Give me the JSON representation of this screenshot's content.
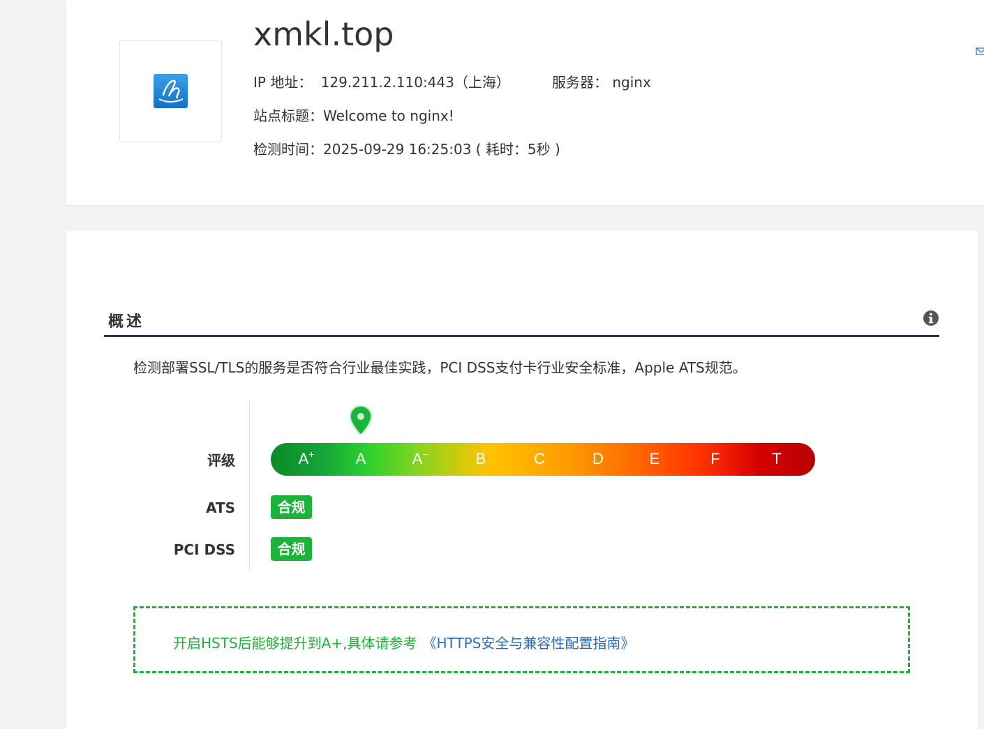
{
  "header": {
    "domain": "xmkl.top",
    "ip_label": "IP 地址：",
    "ip_value": "129.211.2.110:443（上海）",
    "server_label": "服务器：",
    "server_value": "nginx",
    "site_title_label": "站点标题：",
    "site_title_value": "Welcome to nginx!",
    "check_time_label": "检测时间：",
    "check_time_value": "2025-09-29 16:25:03 ( 耗时：5秒 )",
    "logo_icon": "site-favicon-h",
    "mail_icon": "envelope-icon"
  },
  "overview": {
    "title": "概述",
    "info_icon": "info-circle-icon",
    "description": "检测部署SSL/TLS的服务是否符合行业最佳实践，PCI DSS支付卡行业安全标准，Apple ATS规范。",
    "grade_label": "评级",
    "grades": [
      "A",
      "A",
      "A",
      "B",
      "C",
      "D",
      "E",
      "F",
      "T"
    ],
    "grade_superscripts": [
      "+",
      "",
      "−",
      "",
      "",
      "",
      "",
      "",
      ""
    ],
    "current_grade": "A",
    "ats_label": "ATS",
    "ats_status": "合规",
    "pci_label": "PCI DSS",
    "pci_status": "合规",
    "tip_text": "开启HSTS后能够提升到A+,具体请参考",
    "tip_link": "《HTTPS安全与兼容性配置指南》"
  },
  "colors": {
    "compliant_green": "#1db33a",
    "link_blue": "#2a6db5",
    "section_underline": "#243352"
  }
}
